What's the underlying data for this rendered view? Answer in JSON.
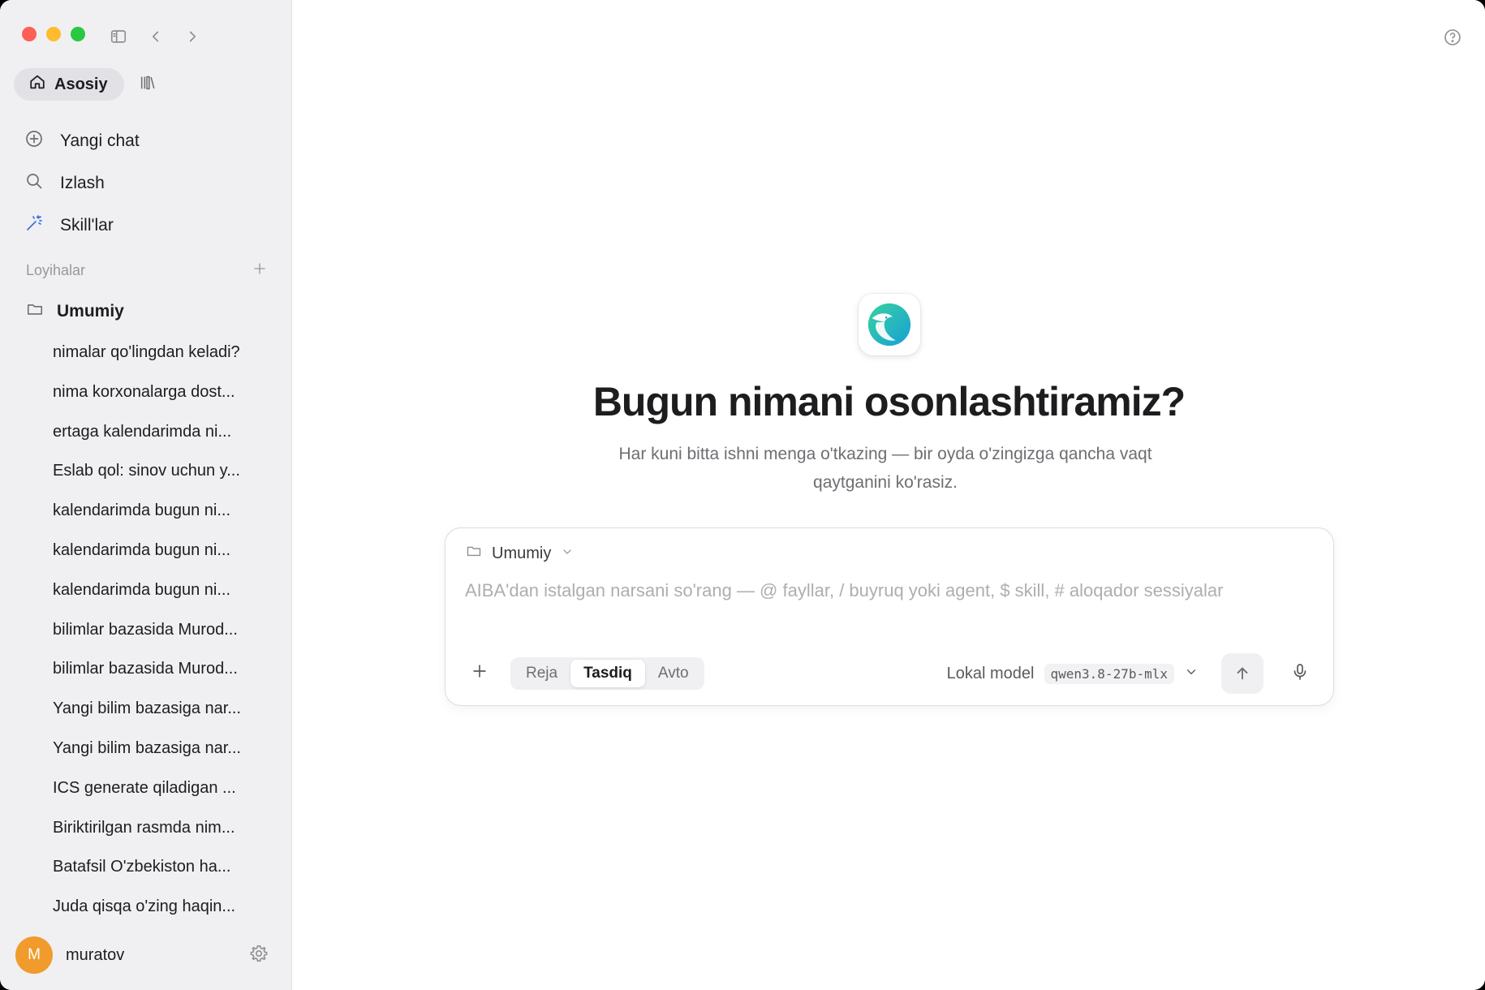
{
  "sidebar": {
    "mode_tab": "Asosiy",
    "nav": {
      "new_chat": "Yangi chat",
      "search": "Izlash",
      "skills": "Skill'lar"
    },
    "projects_header": "Loyihalar",
    "project_folder": "Umumiy",
    "chats": [
      "nimalar qo'lingdan keladi?",
      "nima korxonalarga dost...",
      "ertaga kalendarimda ni...",
      "Eslab qol: sinov uchun y...",
      "kalendarimda bugun ni...",
      "kalendarimda bugun ni...",
      "kalendarimda bugun ni...",
      "bilimlar bazasida Murod...",
      "bilimlar bazasida Murod...",
      "Yangi bilim bazasiga nar...",
      "Yangi bilim bazasiga nar...",
      "ICS generate qiladigan ...",
      "Biriktirilgan rasmda nim...",
      "Batafsil O'zbekiston ha...",
      "Juda qisqa o'zing haqin..."
    ],
    "user": {
      "initial": "M",
      "name": "muratov",
      "avatar_color": "#f19b2c"
    }
  },
  "main": {
    "headline": "Bugun nimani osonlashtiramiz?",
    "subtitle": "Har kuni bitta ishni menga o'tkazing — bir oyda o'zingizga qancha vaqt qaytganini ko'rasiz.",
    "composer": {
      "project": "Umumiy",
      "placeholder": "AIBA'dan istalgan narsani so'rang — @ fayllar, / buyruq yoki agent, $ skill, # aloqador sessiyalar",
      "modes": [
        "Reja",
        "Tasdiq",
        "Avto"
      ],
      "active_mode": "Tasdiq",
      "model_label": "Lokal model",
      "model_name": "qwen3.8-27b-mlx"
    }
  },
  "colors": {
    "traffic_red": "#fe5f57",
    "traffic_yellow": "#febc2e",
    "traffic_green": "#28c840",
    "logo_gradient_start": "#2fc4a6",
    "logo_gradient_end": "#1aa6d8"
  }
}
